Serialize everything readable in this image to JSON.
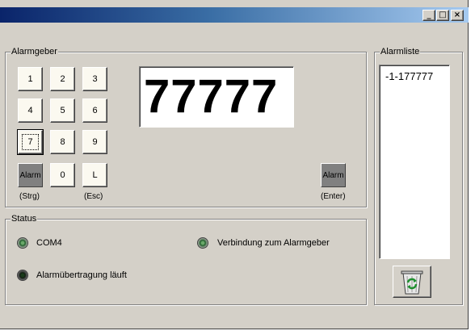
{
  "window": {
    "minimize_glyph": "_",
    "maximize_glyph": "□",
    "close_glyph": "×"
  },
  "alarmgeber": {
    "label": "Alarmgeber",
    "keys": [
      "1",
      "2",
      "3",
      "4",
      "5",
      "6",
      "7",
      "8",
      "9",
      "Alarm",
      "0",
      "L"
    ],
    "captions": {
      "strg": "(Strg)",
      "esc": "(Esc)",
      "enter": "(Enter)"
    },
    "enter_alarm_label": "Alarm",
    "display_value": "77777"
  },
  "status": {
    "label": "Status",
    "com_port": "COM4",
    "connection": "Verbindung zum Alarmgeber",
    "transmission": "Alarmübertragung läuft"
  },
  "alarmliste": {
    "label": "Alarmliste",
    "items": [
      "-1-177777"
    ]
  },
  "icons": {
    "trash_button": "recycle-bin-icon",
    "led": "status-led-icon"
  },
  "colors": {
    "window_bg": "#d4d0c8",
    "key_bg": "#fbf9f0",
    "alarm_key_bg": "#808080",
    "led_green": "#1f5f2a"
  }
}
